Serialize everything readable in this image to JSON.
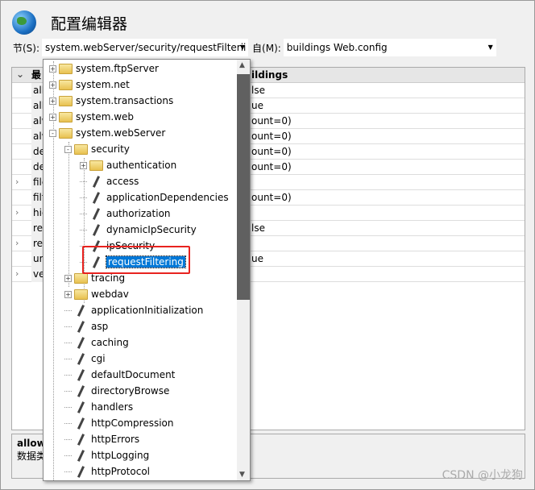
{
  "title": "配置编辑器",
  "toolbar": {
    "section_label": "节(S):",
    "section_value": "system.webServer/security/requestFilterii",
    "from_label": "自(M):",
    "from_value": "buildings Web.config"
  },
  "grid": {
    "header_name": "最",
    "header_value": "ildings",
    "rows": [
      {
        "name": "all",
        "value": "lse",
        "expand": false
      },
      {
        "name": "all",
        "value": "ue",
        "expand": false
      },
      {
        "name": "alw",
        "value": "ount=0)",
        "expand": false
      },
      {
        "name": "alw",
        "value": "ount=0)",
        "expand": false
      },
      {
        "name": "de",
        "value": "ount=0)",
        "expand": false
      },
      {
        "name": "de",
        "value": "ount=0)",
        "expand": false
      },
      {
        "name": "file",
        "value": "",
        "expand": true
      },
      {
        "name": "filt",
        "value": "ount=0)",
        "expand": false
      },
      {
        "name": "hid",
        "value": "",
        "expand": true
      },
      {
        "name": "re",
        "value": "lse",
        "expand": false
      },
      {
        "name": "re",
        "value": "",
        "expand": true
      },
      {
        "name": "un",
        "value": "ue",
        "expand": false
      },
      {
        "name": "ve",
        "value": "",
        "expand": true
      }
    ]
  },
  "description": {
    "title": "allow",
    "text": "数据类"
  },
  "watermark": "CSDN @小龙狗",
  "tree": [
    {
      "label": "system.ftpServer",
      "level": 0,
      "type": "folder",
      "toggle": "+"
    },
    {
      "label": "system.net",
      "level": 0,
      "type": "folder",
      "toggle": "+"
    },
    {
      "label": "system.transactions",
      "level": 0,
      "type": "folder",
      "toggle": "+"
    },
    {
      "label": "system.web",
      "level": 0,
      "type": "folder",
      "toggle": "+"
    },
    {
      "label": "system.webServer",
      "level": 0,
      "type": "folder",
      "toggle": "-"
    },
    {
      "label": "security",
      "level": 1,
      "type": "folder",
      "toggle": "-"
    },
    {
      "label": "authentication",
      "level": 2,
      "type": "folder",
      "toggle": "+"
    },
    {
      "label": "access",
      "level": 2,
      "type": "section"
    },
    {
      "label": "applicationDependencies",
      "level": 2,
      "type": "section"
    },
    {
      "label": "authorization",
      "level": 2,
      "type": "section"
    },
    {
      "label": "dynamicIpSecurity",
      "level": 2,
      "type": "section"
    },
    {
      "label": "ipSecurity",
      "level": 2,
      "type": "section"
    },
    {
      "label": "requestFiltering",
      "level": 2,
      "type": "section",
      "selected": true
    },
    {
      "label": "tracing",
      "level": 1,
      "type": "folder",
      "toggle": "+"
    },
    {
      "label": "webdav",
      "level": 1,
      "type": "folder",
      "toggle": "+"
    },
    {
      "label": "applicationInitialization",
      "level": 1,
      "type": "section"
    },
    {
      "label": "asp",
      "level": 1,
      "type": "section"
    },
    {
      "label": "caching",
      "level": 1,
      "type": "section"
    },
    {
      "label": "cgi",
      "level": 1,
      "type": "section"
    },
    {
      "label": "defaultDocument",
      "level": 1,
      "type": "section"
    },
    {
      "label": "directoryBrowse",
      "level": 1,
      "type": "section"
    },
    {
      "label": "handlers",
      "level": 1,
      "type": "section"
    },
    {
      "label": "httpCompression",
      "level": 1,
      "type": "section"
    },
    {
      "label": "httpErrors",
      "level": 1,
      "type": "section"
    },
    {
      "label": "httpLogging",
      "level": 1,
      "type": "section"
    },
    {
      "label": "httpProtocol",
      "level": 1,
      "type": "section"
    }
  ],
  "colors": {
    "selection": "#0078d7",
    "highlight_box": "#e8231f"
  }
}
